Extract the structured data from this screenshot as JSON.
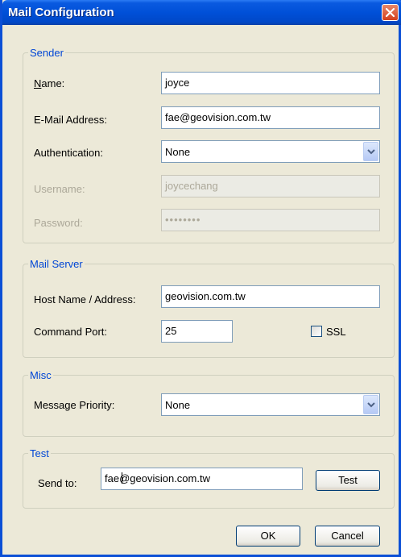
{
  "window": {
    "title": "Mail Configuration"
  },
  "sender": {
    "legend": "Sender",
    "name_label": "Name:",
    "name_value": "joyce",
    "email_label": "E-Mail Address:",
    "email_value": "fae@geovision.com.tw",
    "auth_label": "Authentication:",
    "auth_value": "None",
    "username_label": "Username:",
    "username_value": "joycechang",
    "password_label": "Password:",
    "password_value": "••••••••"
  },
  "mail_server": {
    "legend": "Mail Server",
    "host_label": "Host Name / Address:",
    "host_value": "geovision.com.tw",
    "port_label": "Command Port:",
    "port_value": "25",
    "ssl_label": "SSL",
    "ssl_checked": false
  },
  "misc": {
    "legend": "Misc",
    "priority_label": "Message Priority:",
    "priority_value": "None"
  },
  "test": {
    "legend": "Test",
    "send_to_label": "Send to:",
    "send_to_value": "fae@geovision.com.tw",
    "test_button": "Test"
  },
  "footer": {
    "ok": "OK",
    "cancel": "Cancel"
  },
  "colors": {
    "titlebar": "#0050d8",
    "legend": "#0046d5",
    "dialog_bg": "#ece9d8"
  }
}
